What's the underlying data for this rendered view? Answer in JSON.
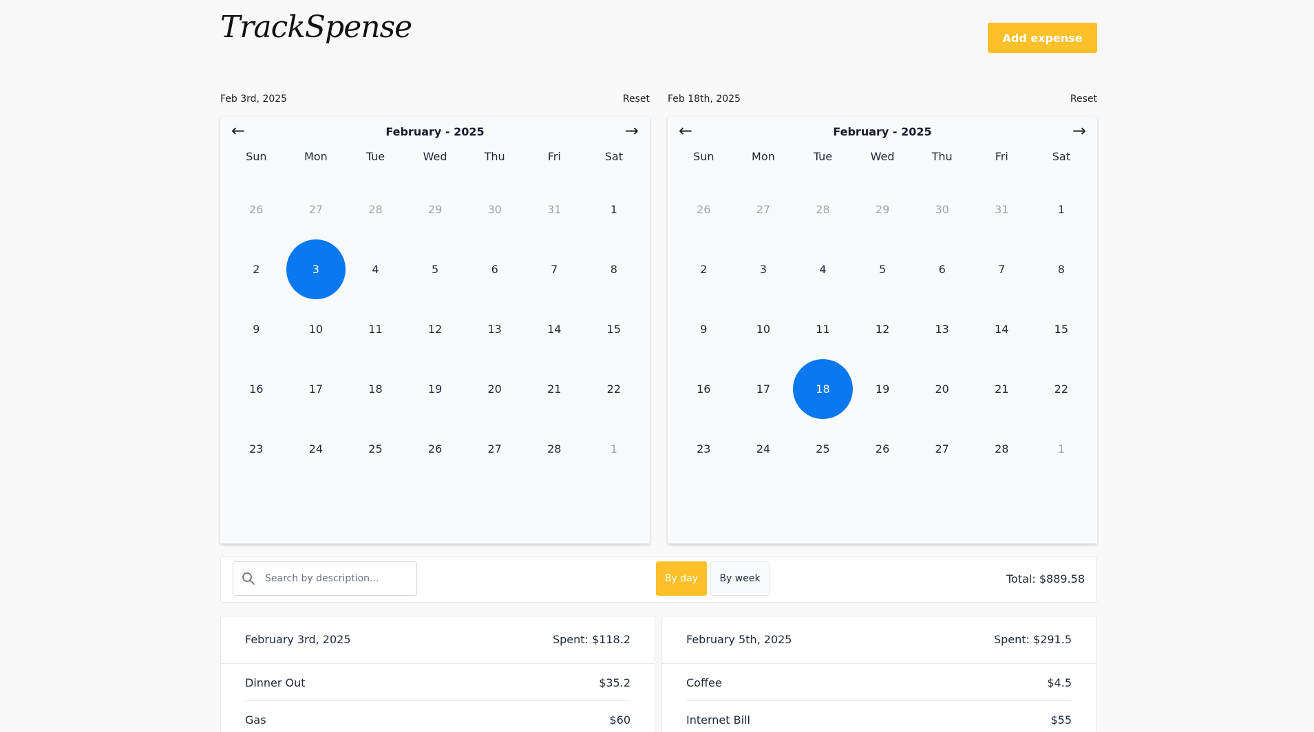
{
  "app": {
    "logo": "TrackSpense",
    "add_expense_label": "Add expense"
  },
  "pickers": [
    {
      "selected_date": "Feb 3rd, 2025",
      "reset_label": "Reset",
      "month_title": "February - 2025",
      "weekdays": [
        "Sun",
        "Mon",
        "Tue",
        "Wed",
        "Thu",
        "Fri",
        "Sat"
      ],
      "days": [
        {
          "d": "26",
          "muted": true
        },
        {
          "d": "27",
          "muted": true
        },
        {
          "d": "28",
          "muted": true
        },
        {
          "d": "29",
          "muted": true
        },
        {
          "d": "30",
          "muted": true
        },
        {
          "d": "31",
          "muted": true
        },
        {
          "d": "1"
        },
        {
          "d": "2"
        },
        {
          "d": "3",
          "selected": true
        },
        {
          "d": "4"
        },
        {
          "d": "5"
        },
        {
          "d": "6"
        },
        {
          "d": "7"
        },
        {
          "d": "8"
        },
        {
          "d": "9"
        },
        {
          "d": "10"
        },
        {
          "d": "11"
        },
        {
          "d": "12"
        },
        {
          "d": "13"
        },
        {
          "d": "14"
        },
        {
          "d": "15"
        },
        {
          "d": "16"
        },
        {
          "d": "17"
        },
        {
          "d": "18"
        },
        {
          "d": "19"
        },
        {
          "d": "20"
        },
        {
          "d": "21"
        },
        {
          "d": "22"
        },
        {
          "d": "23"
        },
        {
          "d": "24"
        },
        {
          "d": "25"
        },
        {
          "d": "26"
        },
        {
          "d": "27"
        },
        {
          "d": "28"
        },
        {
          "d": "1",
          "muted": true
        }
      ]
    },
    {
      "selected_date": "Feb 18th, 2025",
      "reset_label": "Reset",
      "month_title": "February - 2025",
      "weekdays": [
        "Sun",
        "Mon",
        "Tue",
        "Wed",
        "Thu",
        "Fri",
        "Sat"
      ],
      "days": [
        {
          "d": "26",
          "muted": true
        },
        {
          "d": "27",
          "muted": true
        },
        {
          "d": "28",
          "muted": true
        },
        {
          "d": "29",
          "muted": true
        },
        {
          "d": "30",
          "muted": true
        },
        {
          "d": "31",
          "muted": true
        },
        {
          "d": "1"
        },
        {
          "d": "2"
        },
        {
          "d": "3"
        },
        {
          "d": "4"
        },
        {
          "d": "5"
        },
        {
          "d": "6"
        },
        {
          "d": "7"
        },
        {
          "d": "8"
        },
        {
          "d": "9"
        },
        {
          "d": "10"
        },
        {
          "d": "11"
        },
        {
          "d": "12"
        },
        {
          "d": "13"
        },
        {
          "d": "14"
        },
        {
          "d": "15"
        },
        {
          "d": "16"
        },
        {
          "d": "17"
        },
        {
          "d": "18",
          "selected": true
        },
        {
          "d": "19"
        },
        {
          "d": "20"
        },
        {
          "d": "21"
        },
        {
          "d": "22"
        },
        {
          "d": "23"
        },
        {
          "d": "24"
        },
        {
          "d": "25"
        },
        {
          "d": "26"
        },
        {
          "d": "27"
        },
        {
          "d": "28"
        },
        {
          "d": "1",
          "muted": true
        }
      ]
    }
  ],
  "filters": {
    "search_placeholder": "Search by description...",
    "by_day_label": "By day",
    "by_week_label": "By week",
    "active_grouping": "By day",
    "total_text": "Total: $889.58"
  },
  "day_cards": [
    {
      "date": "February 3rd, 2025",
      "spent": "Spent: $118.2",
      "expenses": [
        {
          "name": "Dinner Out",
          "amount": "$35.2"
        },
        {
          "name": "Gas",
          "amount": "$60"
        }
      ]
    },
    {
      "date": "February 5th, 2025",
      "spent": "Spent: $291.5",
      "expenses": [
        {
          "name": "Coffee",
          "amount": "$4.5"
        },
        {
          "name": "Internet Bill",
          "amount": "$55"
        }
      ]
    }
  ],
  "colors": {
    "accent": "#fcc02a",
    "selected_day": "#0a78ee",
    "background": "#f9f9f9"
  },
  "icons": {
    "prev_month": "arrow-left-icon",
    "next_month": "arrow-right-icon",
    "search": "search-icon"
  }
}
